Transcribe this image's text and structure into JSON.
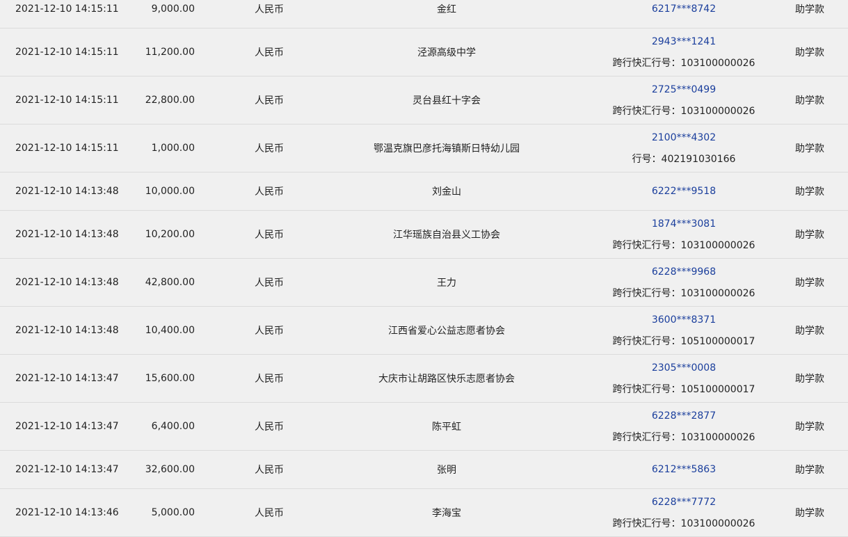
{
  "table": {
    "rows": [
      {
        "datetime": "2021-12-10  14:15:11",
        "amount": "9,000.00",
        "currency": "人民币",
        "payee": "金红",
        "account": "6217***8742",
        "bank_line": "",
        "purpose": "助学款"
      },
      {
        "datetime": "2021-12-10  14:15:11",
        "amount": "11,200.00",
        "currency": "人民币",
        "payee": "泾源高级中学",
        "account": "2943***1241",
        "bank_line": "跨行快汇行号：103100000026",
        "purpose": "助学款"
      },
      {
        "datetime": "2021-12-10  14:15:11",
        "amount": "22,800.00",
        "currency": "人民币",
        "payee": "灵台县红十字会",
        "account": "2725***0499",
        "bank_line": "跨行快汇行号：103100000026",
        "purpose": "助学款"
      },
      {
        "datetime": "2021-12-10  14:15:11",
        "amount": "1,000.00",
        "currency": "人民币",
        "payee": "鄂温克旗巴彦托海镇斯日特幼儿园",
        "account": "2100***4302",
        "bank_line": "行号：402191030166",
        "purpose": "助学款"
      },
      {
        "datetime": "2021-12-10  14:13:48",
        "amount": "10,000.00",
        "currency": "人民币",
        "payee": "刘金山",
        "account": "6222***9518",
        "bank_line": "",
        "purpose": "助学款"
      },
      {
        "datetime": "2021-12-10  14:13:48",
        "amount": "10,200.00",
        "currency": "人民币",
        "payee": "江华瑶族自治县义工协会",
        "account": "1874***3081",
        "bank_line": "跨行快汇行号：103100000026",
        "purpose": "助学款"
      },
      {
        "datetime": "2021-12-10  14:13:48",
        "amount": "42,800.00",
        "currency": "人民币",
        "payee": "王力",
        "account": "6228***9968",
        "bank_line": "跨行快汇行号：103100000026",
        "purpose": "助学款"
      },
      {
        "datetime": "2021-12-10  14:13:48",
        "amount": "10,400.00",
        "currency": "人民币",
        "payee": "江西省爱心公益志愿者协会",
        "account": "3600***8371",
        "bank_line": "跨行快汇行号：105100000017",
        "purpose": "助学款"
      },
      {
        "datetime": "2021-12-10  14:13:47",
        "amount": "15,600.00",
        "currency": "人民币",
        "payee": "大庆市让胡路区快乐志愿者协会",
        "account": "2305***0008",
        "bank_line": "跨行快汇行号：105100000017",
        "purpose": "助学款"
      },
      {
        "datetime": "2021-12-10  14:13:47",
        "amount": "6,400.00",
        "currency": "人民币",
        "payee": "陈平虹",
        "account": "6228***2877",
        "bank_line": "跨行快汇行号：103100000026",
        "purpose": "助学款"
      },
      {
        "datetime": "2021-12-10  14:13:47",
        "amount": "32,600.00",
        "currency": "人民币",
        "payee": "张明",
        "account": "6212***5863",
        "bank_line": "",
        "purpose": "助学款"
      },
      {
        "datetime": "2021-12-10  14:13:46",
        "amount": "5,000.00",
        "currency": "人民币",
        "payee": "李海宝",
        "account": "6228***7772",
        "bank_line": "跨行快汇行号：103100000026",
        "purpose": "助学款"
      }
    ]
  },
  "colors": {
    "background": "#f0f0f0",
    "text": "#222222",
    "account_link": "#1a3e9c",
    "row_divider": "#dcdcdc"
  }
}
